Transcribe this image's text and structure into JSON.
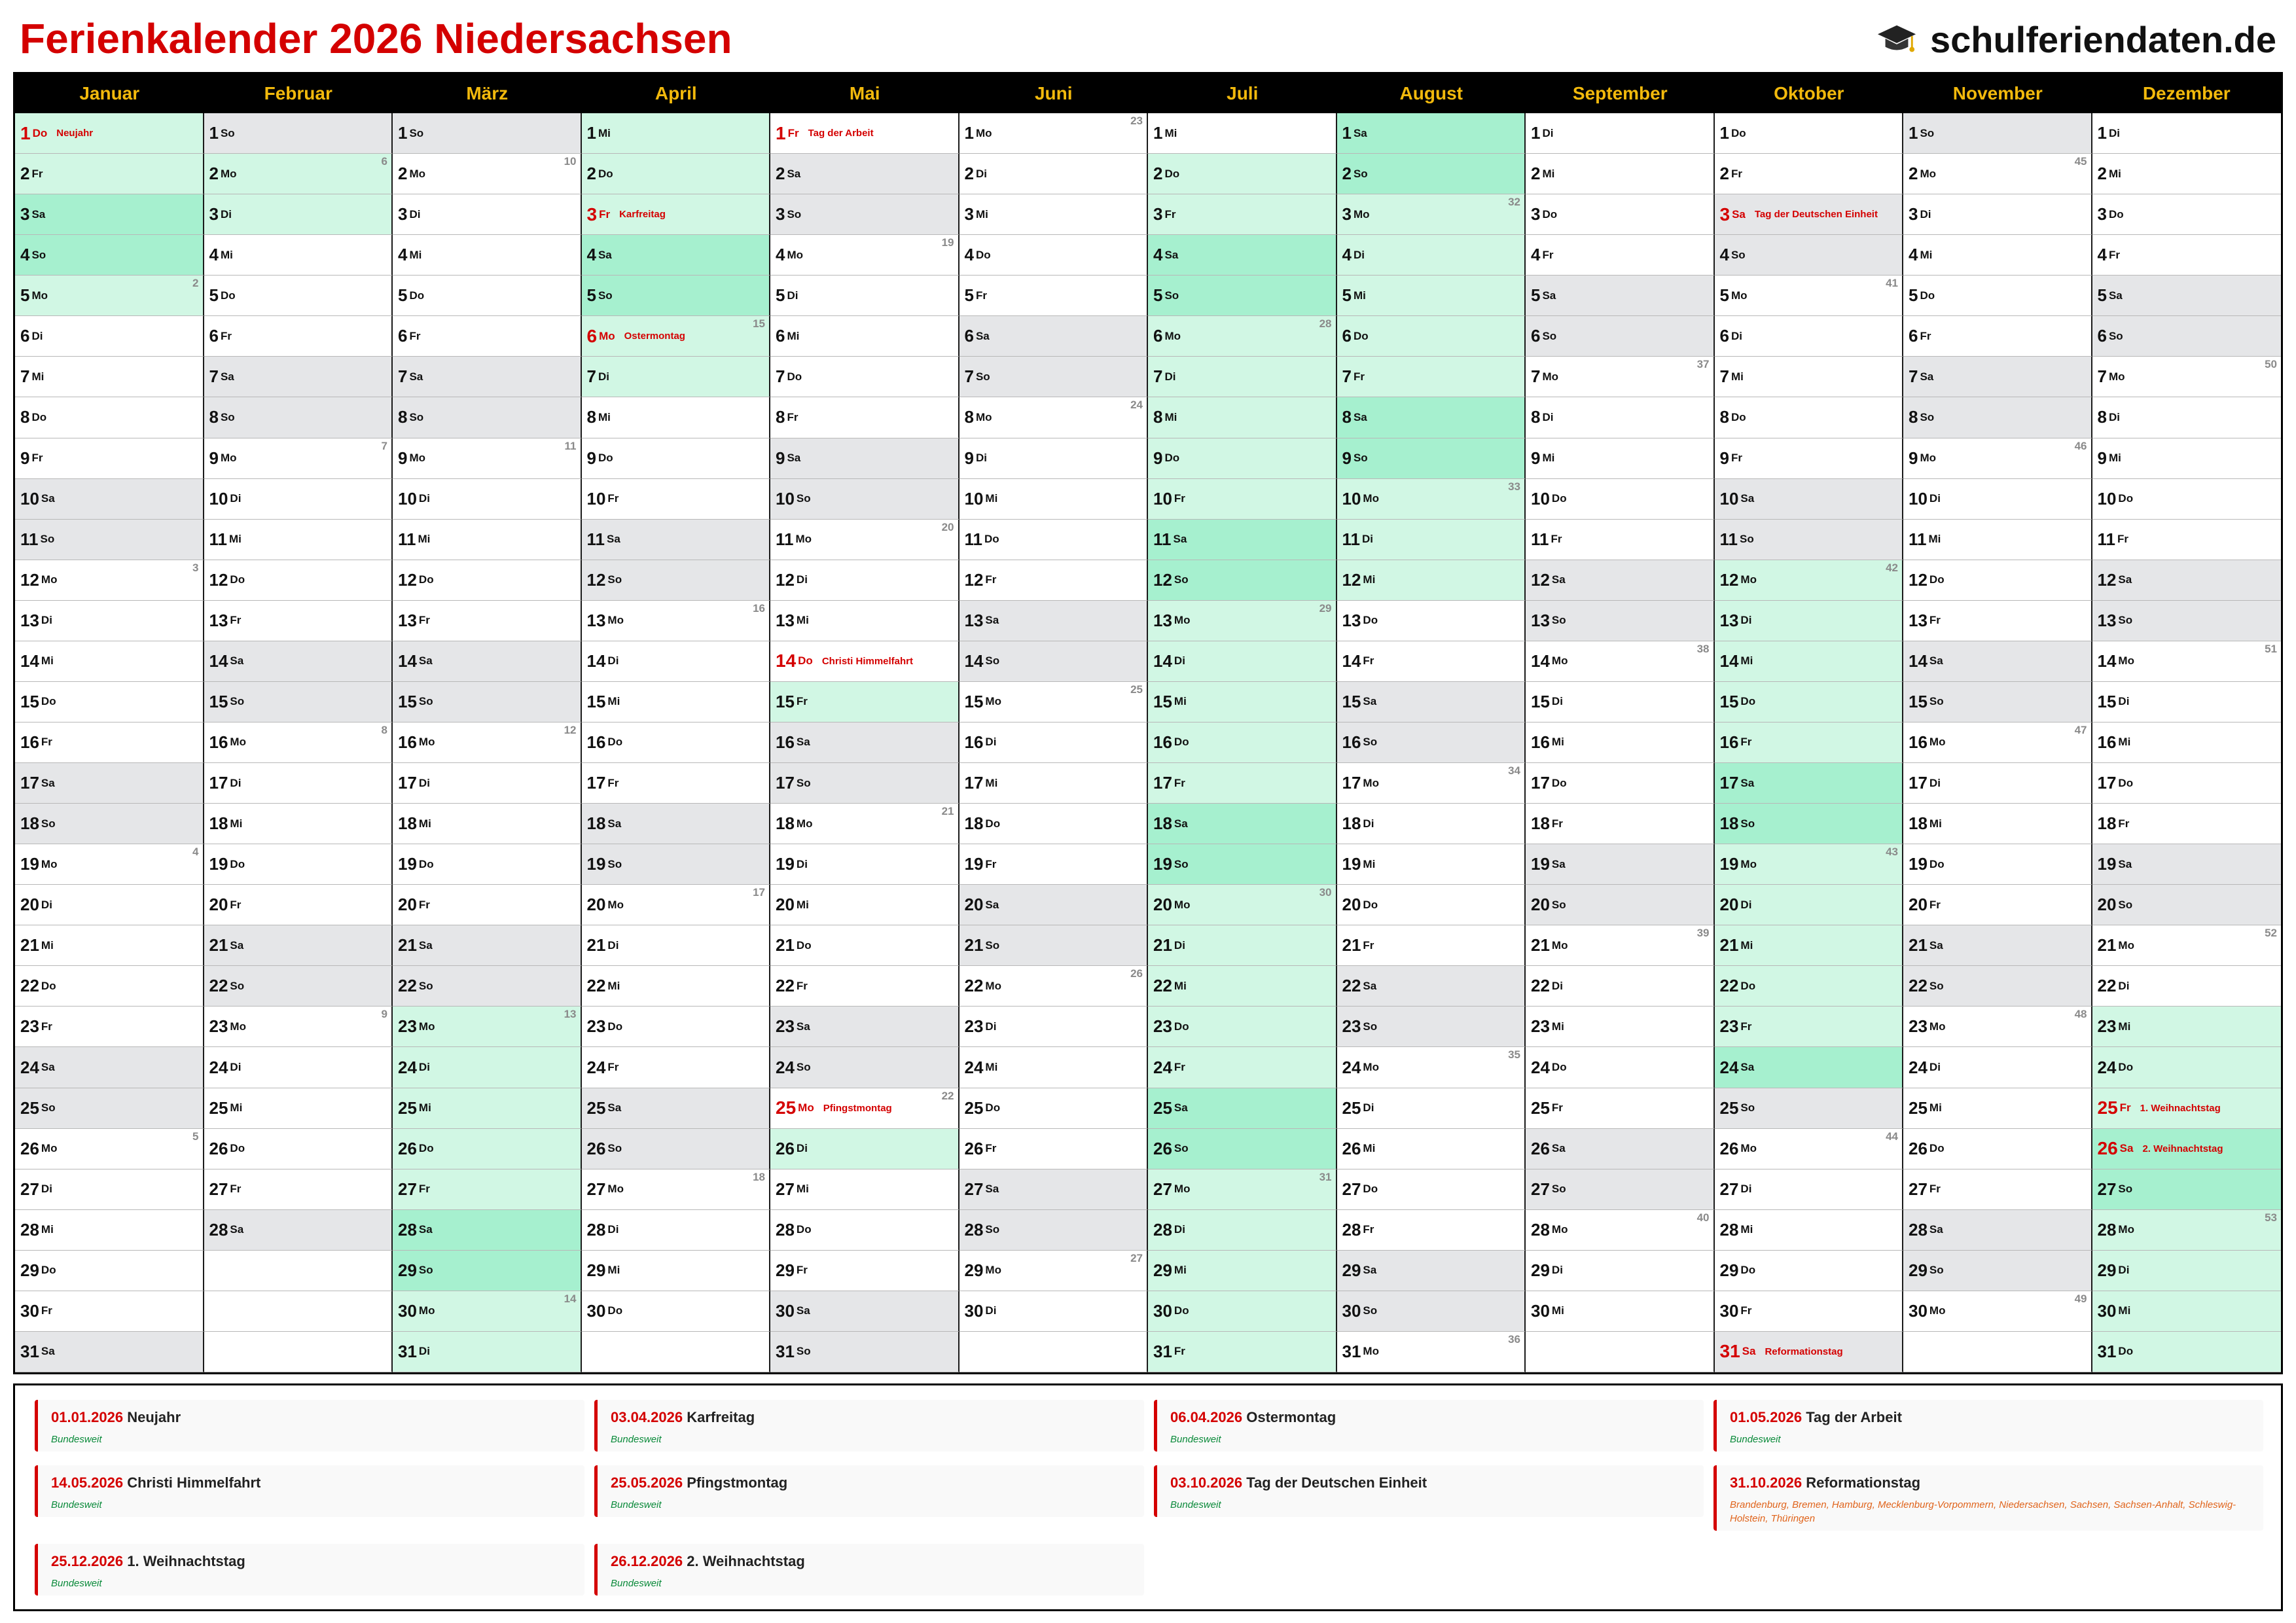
{
  "header": {
    "title": "Ferienkalender 2026 Niedersachsen",
    "brand": "schulferiendaten.de",
    "brand_icon": "graduation-cap-icon"
  },
  "colors": {
    "title": "#d40000",
    "header_bg": "#000000",
    "month_text": "#f2b90c",
    "weekend": "#e5e6e8",
    "holiday": "#d1f7e4",
    "holiday_weekend": "#a6f0cf",
    "public_holiday_text": "#d40000"
  },
  "months": [
    {
      "name": "Januar",
      "days": 31,
      "first_weekday": 4,
      "first_kw": 1
    },
    {
      "name": "Februar",
      "days": 28,
      "first_weekday": 0,
      "first_kw": 5
    },
    {
      "name": "März",
      "days": 31,
      "first_weekday": 0,
      "first_kw": 9
    },
    {
      "name": "April",
      "days": 30,
      "first_weekday": 3,
      "first_kw": 14
    },
    {
      "name": "Mai",
      "days": 31,
      "first_weekday": 5,
      "first_kw": 18
    },
    {
      "name": "Juni",
      "days": 30,
      "first_weekday": 1,
      "first_kw": 23
    },
    {
      "name": "Juli",
      "days": 31,
      "first_weekday": 3,
      "first_kw": 27
    },
    {
      "name": "August",
      "days": 31,
      "first_weekday": 6,
      "first_kw": 31
    },
    {
      "name": "September",
      "days": 30,
      "first_weekday": 2,
      "first_kw": 36
    },
    {
      "name": "Oktober",
      "days": 31,
      "first_weekday": 4,
      "first_kw": 40
    },
    {
      "name": "November",
      "days": 30,
      "first_weekday": 0,
      "first_kw": 44
    },
    {
      "name": "Dezember",
      "days": 31,
      "first_weekday": 2,
      "first_kw": 49
    }
  ],
  "weekdays": [
    "So",
    "Mo",
    "Di",
    "Mi",
    "Do",
    "Fr",
    "Sa"
  ],
  "school_holidays": [
    {
      "month": 1,
      "from": 1,
      "to": 5
    },
    {
      "month": 2,
      "from": 2,
      "to": 3
    },
    {
      "month": 3,
      "from": 23,
      "to": 31
    },
    {
      "month": 4,
      "from": 1,
      "to": 7
    },
    {
      "month": 5,
      "from": 15,
      "to": 15
    },
    {
      "month": 5,
      "from": 26,
      "to": 26
    },
    {
      "month": 7,
      "from": 2,
      "to": 31
    },
    {
      "month": 8,
      "from": 1,
      "to": 12
    },
    {
      "month": 10,
      "from": 12,
      "to": 24
    },
    {
      "month": 12,
      "from": 23,
      "to": 31
    }
  ],
  "public_holidays": [
    {
      "month": 1,
      "day": 1,
      "name": "Neujahr"
    },
    {
      "month": 4,
      "day": 3,
      "name": "Karfreitag"
    },
    {
      "month": 4,
      "day": 6,
      "name": "Ostermontag"
    },
    {
      "month": 5,
      "day": 1,
      "name": "Tag der Arbeit"
    },
    {
      "month": 5,
      "day": 14,
      "name": "Christi Himmelfahrt"
    },
    {
      "month": 5,
      "day": 25,
      "name": "Pfingstmontag"
    },
    {
      "month": 10,
      "day": 3,
      "name": "Tag der Deutschen Einheit"
    },
    {
      "month": 10,
      "day": 31,
      "name": "Reformationstag"
    },
    {
      "month": 12,
      "day": 25,
      "name": "1. Weihnachtstag"
    },
    {
      "month": 12,
      "day": 26,
      "name": "2. Weihnachtstag"
    }
  ],
  "legend": [
    {
      "date": "01.01.2026",
      "name": "Neujahr",
      "scope": "Bundesweit",
      "regional": false
    },
    {
      "date": "03.04.2026",
      "name": "Karfreitag",
      "scope": "Bundesweit",
      "regional": false
    },
    {
      "date": "06.04.2026",
      "name": "Ostermontag",
      "scope": "Bundesweit",
      "regional": false
    },
    {
      "date": "01.05.2026",
      "name": "Tag der Arbeit",
      "scope": "Bundesweit",
      "regional": false
    },
    {
      "date": "14.05.2026",
      "name": "Christi Himmelfahrt",
      "scope": "Bundesweit",
      "regional": false
    },
    {
      "date": "25.05.2026",
      "name": "Pfingstmontag",
      "scope": "Bundesweit",
      "regional": false
    },
    {
      "date": "03.10.2026",
      "name": "Tag der Deutschen Einheit",
      "scope": "Bundesweit",
      "regional": false
    },
    {
      "date": "31.10.2026",
      "name": "Reformationstag",
      "scope": "Brandenburg, Bremen, Hamburg, Mecklenburg-Vorpommern, Niedersachsen, Sachsen, Sachsen-Anhalt, Schleswig-Holstein, Thüringen",
      "regional": true
    },
    {
      "date": "25.12.2026",
      "name": "1. Weihnachtstag",
      "scope": "Bundesweit",
      "regional": false
    },
    {
      "date": "26.12.2026",
      "name": "2. Weihnachtstag",
      "scope": "Bundesweit",
      "regional": false
    }
  ]
}
